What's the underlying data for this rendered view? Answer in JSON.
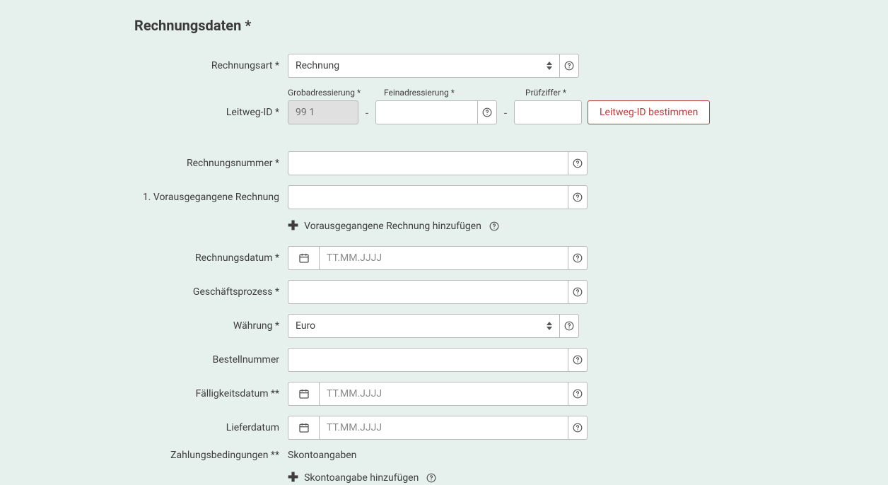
{
  "section_title": "Rechnungsdaten *",
  "labels": {
    "rechnungsart": "Rechnungsart *",
    "leitweg": "Leitweg-ID *",
    "grob": "Grobadressierung *",
    "fein": "Feinadressierung *",
    "pruef": "Prüfziffer *",
    "leitweg_btn": "Leitweg-ID bestimmen",
    "rechnungsnummer": "Rechnungsnummer *",
    "vorausgegangene": "1. Vorausgegangene Rechnung",
    "add_voraus": "Vorausgegangene Rechnung hinzufügen",
    "rechnungsdatum": "Rechnungsdatum *",
    "geschaeftsprozess": "Geschäftsprozess *",
    "waehrung": "Währung *",
    "bestellnummer": "Bestellnummer",
    "faelligkeitsdatum": "Fälligkeitsdatum **",
    "lieferdatum": "Lieferdatum",
    "zahlungsbedingungen": "Zahlungsbedingungen **",
    "skontoangaben": "Skontoangaben",
    "add_skonto": "Skontoangabe hinzufügen"
  },
  "values": {
    "rechnungsart_selected": "Rechnung",
    "grob": "99 1",
    "fein": "",
    "pruef": "",
    "rechnungsnummer": "",
    "vorausgegangene": "",
    "rechnungsdatum": "",
    "date_placeholder": "TT.MM.JJJJ",
    "geschaeftsprozess": "",
    "waehrung_selected": "Euro",
    "bestellnummer": "",
    "faelligkeitsdatum": "",
    "lieferdatum": ""
  }
}
